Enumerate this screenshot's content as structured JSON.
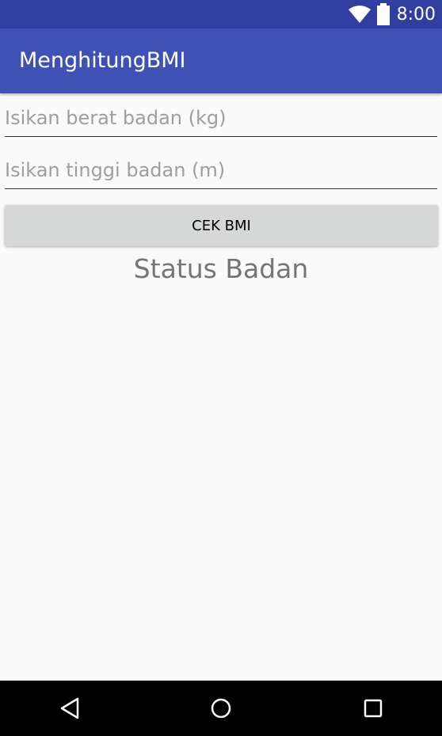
{
  "status_bar": {
    "time": "8:00",
    "color": "#303f9f"
  },
  "app_bar": {
    "title": "MenghitungBMI",
    "color": "#3f51b5"
  },
  "form": {
    "weight_placeholder": "Isikan berat badan (kg)",
    "height_placeholder": "Isikan tinggi badan (m)",
    "button_label": "CEK BMI",
    "result_text": "Status Badan"
  },
  "icons": {
    "status": [
      "wifi-icon",
      "battery-icon"
    ],
    "nav": [
      "back-icon",
      "home-icon",
      "recents-icon"
    ]
  }
}
